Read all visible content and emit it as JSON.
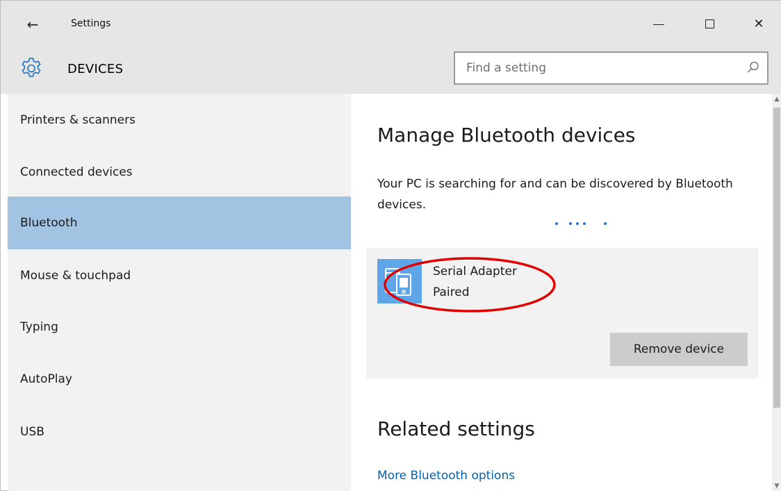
{
  "window": {
    "back_glyph": "←",
    "title": "Settings",
    "minimize_label": "Minimize",
    "maximize_label": "Maximize",
    "close_glyph": "✕"
  },
  "header": {
    "section_title": "DEVICES",
    "section_icon": "gear-icon",
    "search_placeholder": "Find a setting",
    "search_icon": "search-icon"
  },
  "sidebar": {
    "items": [
      {
        "label": "Printers & scanners",
        "selected": false
      },
      {
        "label": "Connected devices",
        "selected": false
      },
      {
        "label": "Bluetooth",
        "selected": true
      },
      {
        "label": "Mouse & touchpad",
        "selected": false
      },
      {
        "label": "Typing",
        "selected": false
      },
      {
        "label": "AutoPlay",
        "selected": false
      },
      {
        "label": "USB",
        "selected": false
      }
    ]
  },
  "main": {
    "heading": "Manage Bluetooth devices",
    "status_text": "Your PC is searching for and can be discovered by Bluetooth devices.",
    "device": {
      "icon": "phone-device-icon",
      "name": "Serial Adapter",
      "status": "Paired",
      "remove_label": "Remove device"
    },
    "related_heading": "Related settings",
    "more_link": "More Bluetooth options"
  },
  "colors": {
    "selected_nav": "#a3c3e3",
    "sidebar_bg": "#f2f2f2",
    "titlebar_bg": "#e6e6e6",
    "link": "#0063b1",
    "device_icon_bg": "#5ea6e8",
    "annotation": "#e00000"
  }
}
